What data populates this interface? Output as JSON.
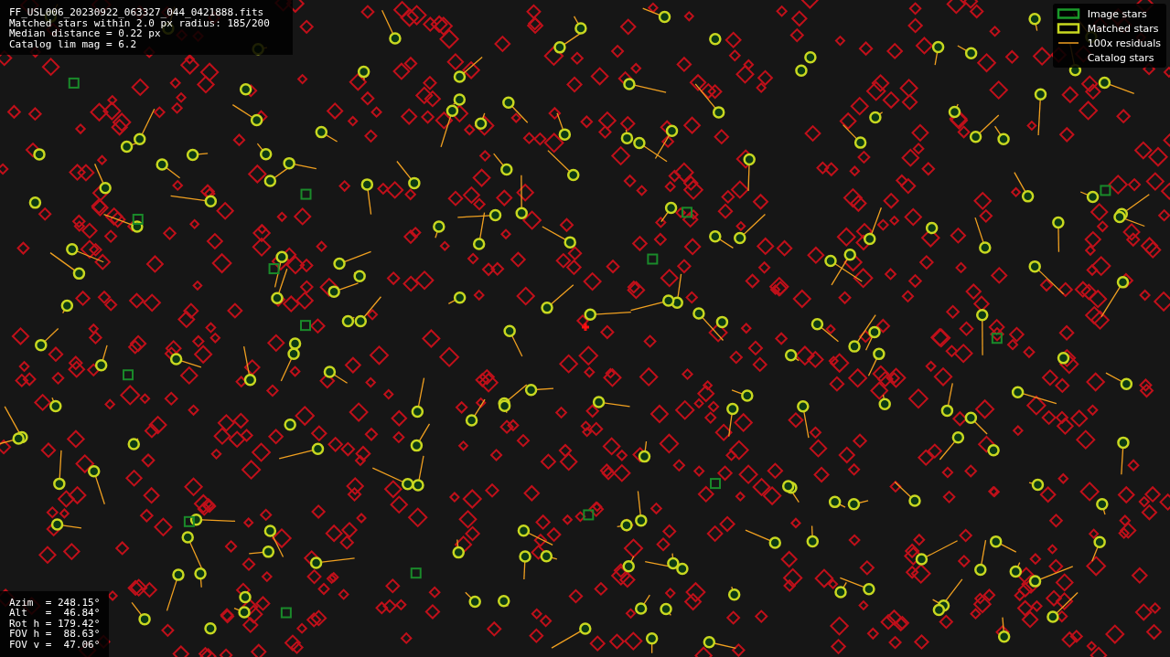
{
  "info_lines": [
    "FF_USL006_20230922_063327_044_0421888.fits",
    "Matched stars within 2.0 px radius: 185/200",
    "Median distance = 0.22 px",
    "Catalog lim mag = 6.2"
  ],
  "legend": [
    {
      "kind": "image",
      "label": "Image stars"
    },
    {
      "kind": "matched",
      "label": "Matched stars"
    },
    {
      "kind": "residual",
      "label": "100x residuals"
    },
    {
      "kind": "catalog",
      "label": "Catalog stars"
    }
  ],
  "pointing": [
    "Azim  = 248.15°",
    "Alt   =  46.84°",
    "Rot h = 179.42°",
    "FOV h =  88.63°",
    "FOV v =  47.06°"
  ]
}
